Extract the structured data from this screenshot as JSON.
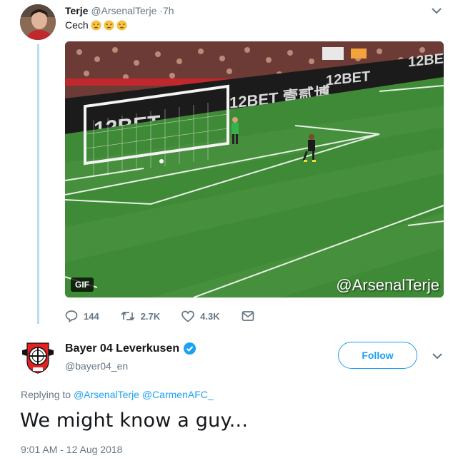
{
  "quoted_tweet": {
    "author_name": "Terje",
    "author_handle": "@ArsenalTerje",
    "time": "·7h",
    "text": "Cech",
    "emojis": [
      "weary-face-emoji",
      "weary-face-emoji",
      "weary-face-emoji"
    ],
    "media": {
      "badge": "GIF",
      "watermark": "@ArsenalTerje",
      "ad_boards": [
        "12BET",
        "12BET 壹贰博",
        "12BET",
        "12BE"
      ]
    },
    "actions": {
      "replies": "144",
      "retweets": "2.7K",
      "likes": "4.3K"
    }
  },
  "main_tweet": {
    "author_name": "Bayer 04 Leverkusen",
    "author_handle": "@bayer04_en",
    "verified": true,
    "follow_label": "Follow",
    "replying_to_label": "Replying to",
    "replying_to": [
      "@ArsenalTerje",
      "@CarmenAFC_"
    ],
    "text": "We might know a guy...",
    "timestamp": "9:01 AM - 12 Aug 2018"
  },
  "colors": {
    "accent": "#1da1f2",
    "secondary_text": "#657786",
    "thread_line": "#b9dcf2",
    "pitch_green": "#3f8a36"
  }
}
